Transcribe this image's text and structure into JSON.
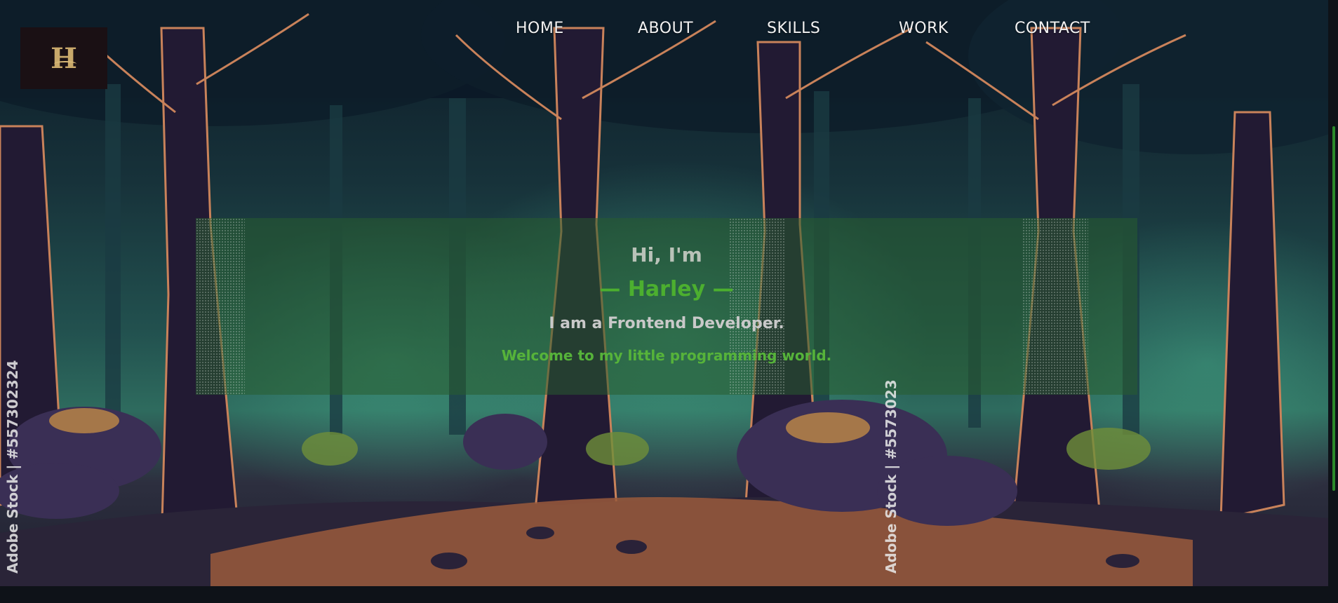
{
  "logo": {
    "glyph": "H",
    "icon": "h-monogram-logo"
  },
  "nav": {
    "items": [
      {
        "label": "HOME"
      },
      {
        "label": "ABOUT"
      },
      {
        "label": "SKILLS"
      },
      {
        "label": "WORK"
      },
      {
        "label": "CONTACT"
      }
    ]
  },
  "hero": {
    "greeting": "Hi, I'm",
    "name": "— Harley —",
    "role": "I am a Frontend Developer.",
    "welcome": "Welcome to my little programming world."
  },
  "watermarks": {
    "left": "Adobe Stock | #557302324",
    "middle": "Adobe Stock | #5573023"
  },
  "colors": {
    "accent_green": "#4caf2f",
    "hero_band": "#285c30",
    "nav_text": "#f2f2f2"
  }
}
